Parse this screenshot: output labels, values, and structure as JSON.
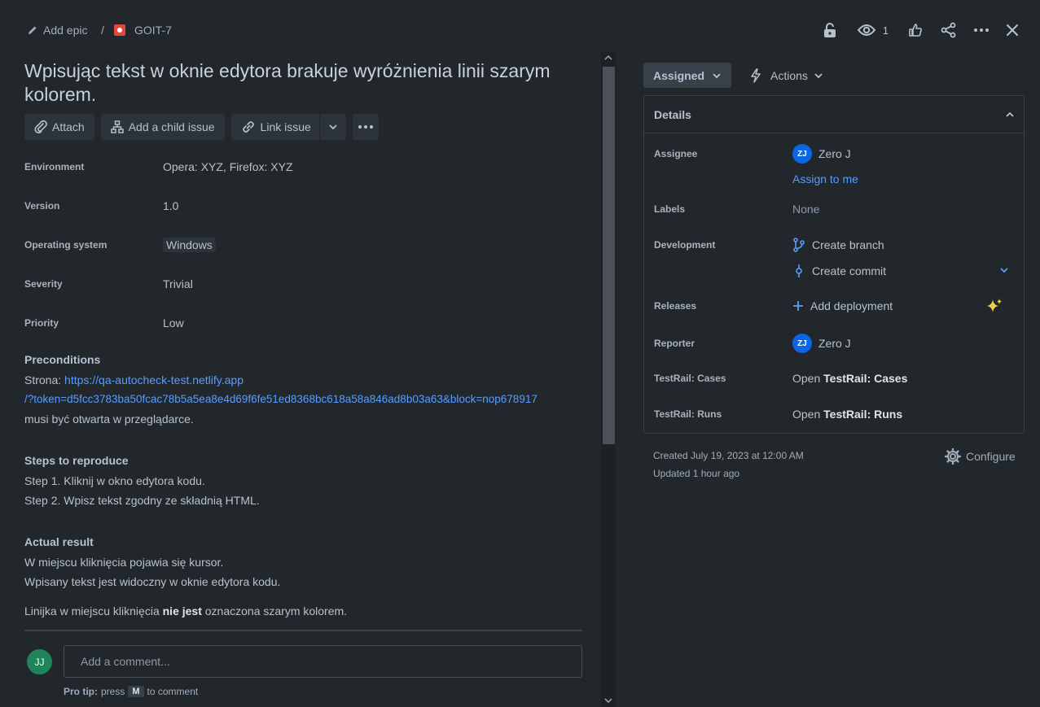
{
  "breadcrumb": {
    "add_epic": "Add epic",
    "separator": "/",
    "issue_key": "GOIT-7"
  },
  "top_actions": {
    "watch_count": "1"
  },
  "issue": {
    "title": "Wpisując tekst w oknie edytora brakuje wyróżnienia linii szarym kolorem."
  },
  "toolbar": {
    "attach": "Attach",
    "add_child": "Add a child issue",
    "link_issue": "Link issue"
  },
  "fields": [
    {
      "label": "Environment",
      "value": "Opera: XYZ, Firefox: XYZ"
    },
    {
      "label": "Version",
      "value": "1.0"
    },
    {
      "label": "Operating system",
      "value": "Windows"
    },
    {
      "label": "Severity",
      "value": "Trivial"
    },
    {
      "label": "Priority",
      "value": "Low"
    }
  ],
  "preconditions": {
    "heading": "Preconditions",
    "prefix": "Strona: ",
    "url_line1": "https://qa-autocheck-test.netlify.app",
    "url_line2": "/?token=d5fcc3783ba50fcac78b5a5ea8e4d69f6fe51ed8368bc618a58a846ad8b03a63&block=nop678917",
    "suffix": "musi być otwarta w przeglądarce."
  },
  "steps": {
    "heading": "Steps to reproduce",
    "step1": "Step 1. Kliknij w okno edytora kodu.",
    "step2": "Step 2. Wpisz tekst zgodny ze składnią HTML."
  },
  "actual": {
    "heading": "Actual result",
    "line1": "W miejscu kliknięcia pojawia się kursor.",
    "line2": "Wpisany tekst jest widoczny w oknie edytora kodu.",
    "line3_pre": "Linijka w miejscu kliknięcia ",
    "line3_bold": "nie jest",
    "line3_post": " oznaczona szarym kolorem."
  },
  "comment": {
    "avatar": "JJ",
    "placeholder": "Add a comment...",
    "protip_label": "Pro tip:",
    "protip_press": "press",
    "protip_key": "M",
    "protip_rest": "to comment"
  },
  "status": {
    "assigned": "Assigned",
    "actions": "Actions"
  },
  "details": {
    "heading": "Details",
    "assignee_label": "Assignee",
    "assignee_initials": "ZJ",
    "assignee_name": "Zero J",
    "assign_to_me": "Assign to me",
    "labels_label": "Labels",
    "labels_value": "None",
    "development_label": "Development",
    "create_branch": "Create branch",
    "create_commit": "Create commit",
    "releases_label": "Releases",
    "add_deployment": "Add deployment",
    "reporter_label": "Reporter",
    "reporter_initials": "ZJ",
    "reporter_name": "Zero J",
    "tr_cases_label": "TestRail: Cases",
    "tr_cases_open": "Open ",
    "tr_cases_bold": "TestRail: Cases",
    "tr_runs_label": "TestRail: Runs",
    "tr_runs_open": "Open ",
    "tr_runs_bold": "TestRail: Runs"
  },
  "meta": {
    "created": "Created July 19, 2023 at 12:00 AM",
    "updated": "Updated 1 hour ago",
    "configure": "Configure"
  },
  "colors": {
    "background": "#22272b",
    "link": "#579dff",
    "bug_icon": "#e2483d",
    "ai_sparkle": "#f5cd47"
  }
}
